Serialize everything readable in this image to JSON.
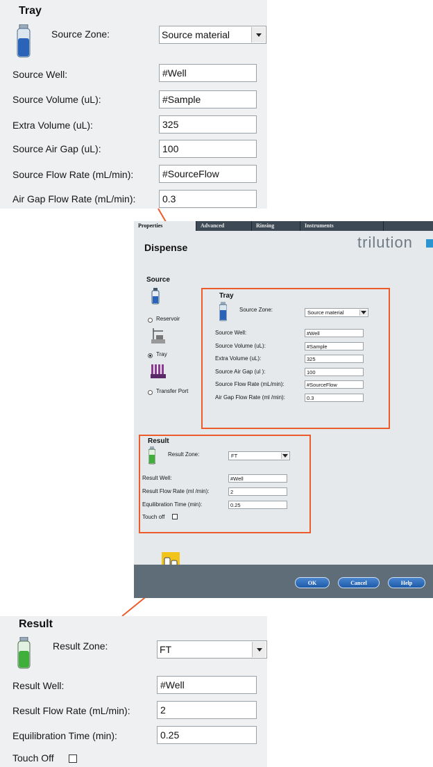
{
  "tray_zoom": {
    "title": "Tray",
    "source_zone_label": "Source Zone:",
    "source_zone_value": "Source material",
    "source_well_label": "Source Well:",
    "source_well_value": "#Well",
    "source_volume_label": "Source Volume (uL):",
    "source_volume_value": "#Sample",
    "extra_volume_label": "Extra Volume (uL):",
    "extra_volume_value": "325",
    "air_gap_label": "Source Air Gap (uL):",
    "air_gap_value": "100",
    "flow_rate_label": "Source Flow Rate (mL/min):",
    "flow_rate_value": "#SourceFlow",
    "air_gap_flow_label": "Air Gap Flow Rate (mL/min):",
    "air_gap_flow_value": "0.3"
  },
  "window": {
    "tabs": [
      "Properties",
      "Advanced",
      "Rinsing",
      "Instruments"
    ],
    "heading": "Dispense",
    "brand": "trilution",
    "source_heading": "Source",
    "source_options": [
      "Reservoir",
      "Tray",
      "Transfer Port"
    ],
    "selected_source": "Tray",
    "tray": {
      "title": "Tray",
      "source_zone_label": "Source Zone:",
      "source_zone_value": "Source material",
      "source_well_label": "Source Well:",
      "source_well_value": "#Well",
      "source_volume_label": "Source Volume (uL):",
      "source_volume_value": "#Sample",
      "extra_volume_label": "Extra Volume (uL):",
      "extra_volume_value": "325",
      "air_gap_label": "Source Air Gap (ul ):",
      "air_gap_value": "100",
      "flow_rate_label": "Source Flow Rate (mL/min):",
      "flow_rate_value": "#SourceFlow",
      "air_gap_flow_label": "Air Gap Flow Rate (ml /min):",
      "air_gap_flow_value": "0.3"
    },
    "result": {
      "title": "Result",
      "result_zone_label": "Result Zone:",
      "result_zone_value": "FT",
      "result_well_label": "Result Well:",
      "result_well_value": "#Well",
      "flow_rate_label": "Result Flow Rate (ml /min):",
      "flow_rate_value": "2",
      "equilibration_label": "Equilibration Time (min):",
      "equilibration_value": "0.25",
      "touch_off_label": "Touch off"
    },
    "buttons": {
      "ok": "OK",
      "cancel": "Cancel",
      "help": "Help"
    }
  },
  "result_zoom": {
    "title": "Result",
    "result_zone_label": "Result Zone:",
    "result_zone_value": "FT",
    "result_well_label": "Result Well:",
    "result_well_value": "#Well",
    "flow_rate_label": "Result Flow Rate (mL/min):",
    "flow_rate_value": "2",
    "equilibration_label": "Equilibration Time (min):",
    "equilibration_value": "0.25",
    "touch_off_label": "Touch Off"
  },
  "colors": {
    "callout": "#ec5b2a",
    "tray_bottle": "#2a63b8",
    "result_bottle": "#3fae3a",
    "ok_button": "#2a66b3"
  },
  "icons": [
    "blue-bottle-icon",
    "green-bottle-icon",
    "reservoir-bottle-icon",
    "tray-rack-icon",
    "transfer-port-icon",
    "trilution-logo-icon",
    "method-icon"
  ]
}
